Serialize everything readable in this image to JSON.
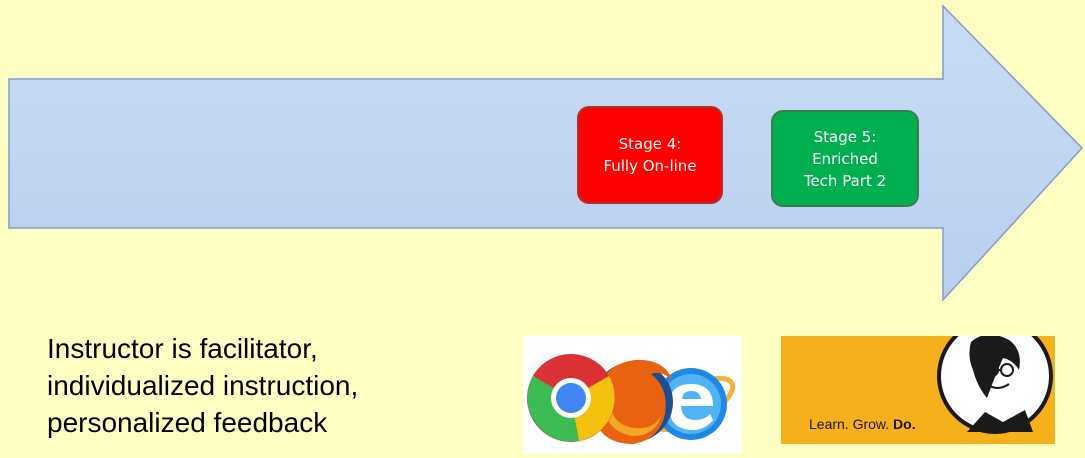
{
  "diagram": {
    "stages": [
      {
        "lines": [
          "Stage 4:",
          "Fully On-line"
        ],
        "color": "#ff0000"
      },
      {
        "lines": [
          "Stage 5:",
          "Enriched",
          "Tech Part 2"
        ],
        "color": "#00b050"
      }
    ],
    "arrow_color": "#c6d9f1",
    "background_color": "#ffffc4"
  },
  "description": {
    "lines": [
      "Instructor is facilitator,",
      "individualized instruction,",
      "personalized feedback"
    ]
  },
  "images": {
    "browsers": {
      "icons": [
        "chrome-icon",
        "firefox-icon",
        "internet-explorer-icon"
      ]
    },
    "lynda": {
      "tagline_prefix": "Learn. Grow.",
      "tagline_bold": "Do.",
      "icon": "lynda-logo-icon"
    }
  }
}
